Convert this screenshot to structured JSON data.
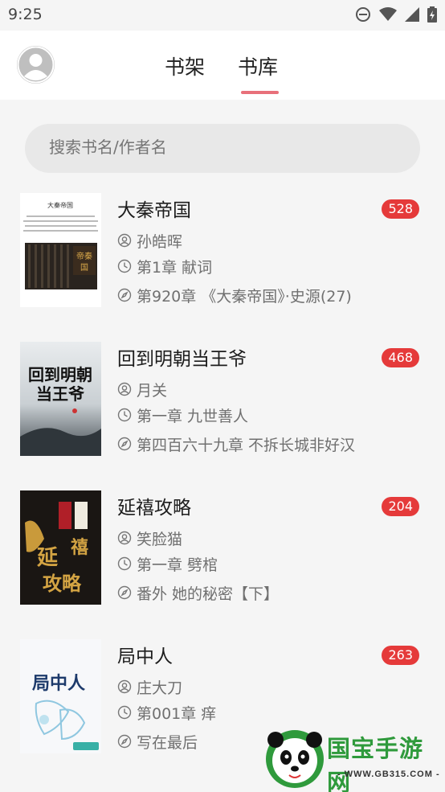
{
  "status_bar": {
    "time": "9:25",
    "icons": [
      "do-not-disturb-icon",
      "wifi-icon",
      "signal-icon",
      "battery-charging-icon"
    ]
  },
  "header": {
    "tabs": [
      {
        "label": "书架",
        "selected": false
      },
      {
        "label": "书库",
        "selected": true
      }
    ],
    "accent": "#e8707a"
  },
  "search": {
    "placeholder": "搜索书名/作者名"
  },
  "books": [
    {
      "title": "大秦帝国",
      "count": "528",
      "author": "孙皓晖",
      "first_chapter": "第1章 献词",
      "latest_chapter": "第920章 《大秦帝国》·史源(27)"
    },
    {
      "title": "回到明朝当王爷",
      "count": "468",
      "author": "月关",
      "first_chapter": "第一章 九世善人",
      "latest_chapter": "第四百六十九章 不拆长城非好汉"
    },
    {
      "title": "延禧攻略",
      "count": "204",
      "author": "笑脸猫",
      "first_chapter": "第一章 劈棺",
      "latest_chapter": "番外 她的秘密【下】"
    },
    {
      "title": "局中人",
      "count": "263",
      "author": "庄大刀",
      "first_chapter": "第001章 痒",
      "latest_chapter": "写在最后"
    }
  ],
  "badge_color": "#e53a3a",
  "watermark": {
    "text": "国宝手游网",
    "url": "- WWW.GB315.COM -"
  }
}
